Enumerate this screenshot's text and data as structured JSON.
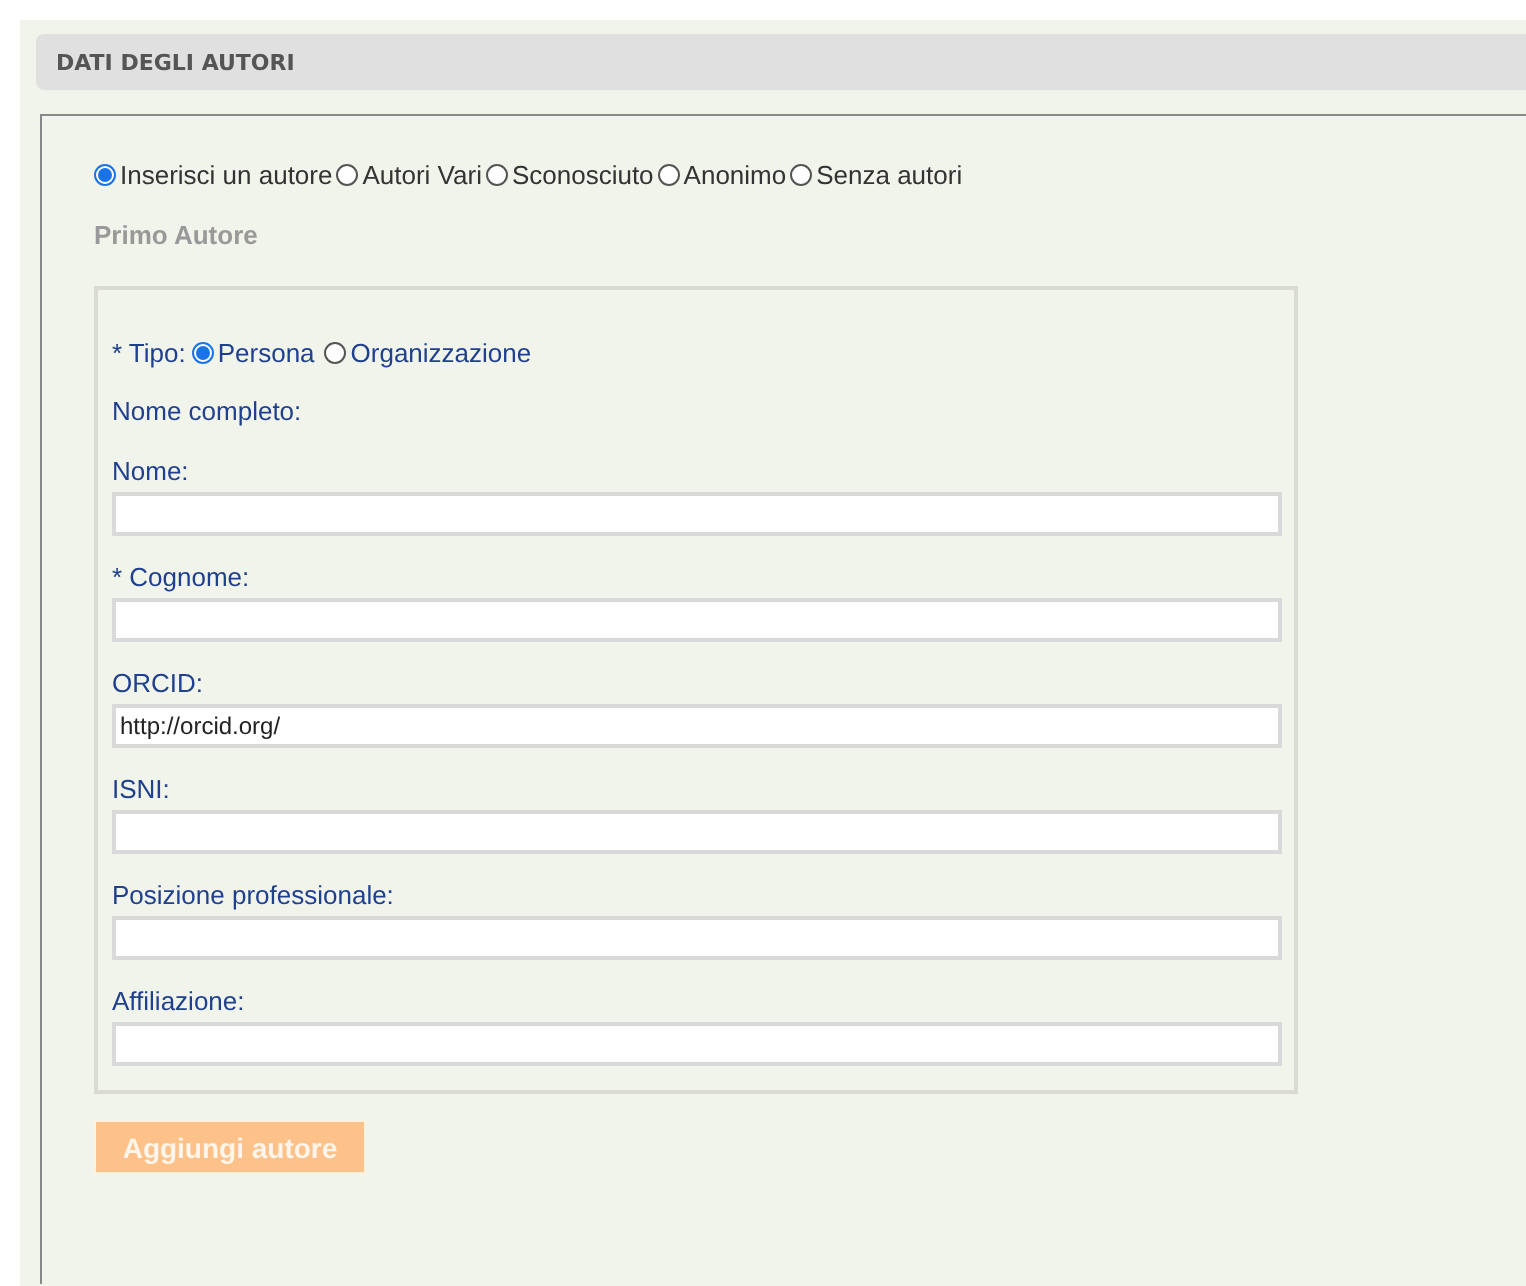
{
  "section": {
    "title": "DATI DEGLI AUTORI"
  },
  "author_mode": [
    {
      "label": "Inserisci un autore",
      "selected": true
    },
    {
      "label": "Autori Vari",
      "selected": false
    },
    {
      "label": "Sconosciuto",
      "selected": false
    },
    {
      "label": "Anonimo",
      "selected": false
    },
    {
      "label": "Senza autori",
      "selected": false
    }
  ],
  "subtitle": "Primo Autore",
  "type": {
    "label": "* Tipo:",
    "options": [
      {
        "label": "Persona",
        "selected": true
      },
      {
        "label": "Organizzazione",
        "selected": false
      }
    ]
  },
  "full_name_label": "Nome completo:",
  "fields": [
    {
      "label": "Nome:"
    },
    {
      "label": "* Cognome:"
    },
    {
      "label": "ORCID:",
      "value": "http://orcid.org/"
    },
    {
      "label": "ISNI:"
    },
    {
      "label": "Posizione professionale:"
    },
    {
      "label": "Affiliazione:"
    }
  ],
  "add_button": {
    "label": "Aggiungi autore",
    "disabled": true
  }
}
